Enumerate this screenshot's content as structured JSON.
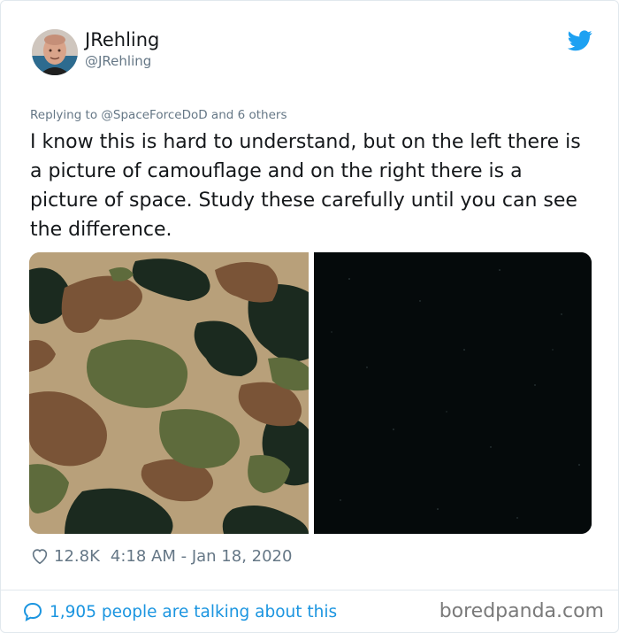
{
  "user": {
    "display_name": "JRehling",
    "handle": "@JRehling",
    "avatar_icon": "profile-photo",
    "brand_icon": "twitter-bird-icon"
  },
  "reply": {
    "prefix": "Replying to ",
    "mention": "@SpaceForceDoD",
    "suffix": " and 6 others"
  },
  "tweet": {
    "text": "I know this is hard to understand, but on the left there is a picture of camouflage and on the right there is a picture of space. Study these carefully until you can see the difference."
  },
  "media": {
    "left_image": "camouflage-pattern",
    "right_image": "space-starfield"
  },
  "meta": {
    "likes": "12.8K",
    "timestamp": "4:18 AM - Jan 18, 2020"
  },
  "footer": {
    "talking_label": "1,905 people are talking about this",
    "watermark": "boredpanda.com"
  },
  "colors": {
    "link": "#1b95e0",
    "muted": "#657786",
    "text": "#14171a",
    "twitter_blue": "#1da1f2"
  }
}
